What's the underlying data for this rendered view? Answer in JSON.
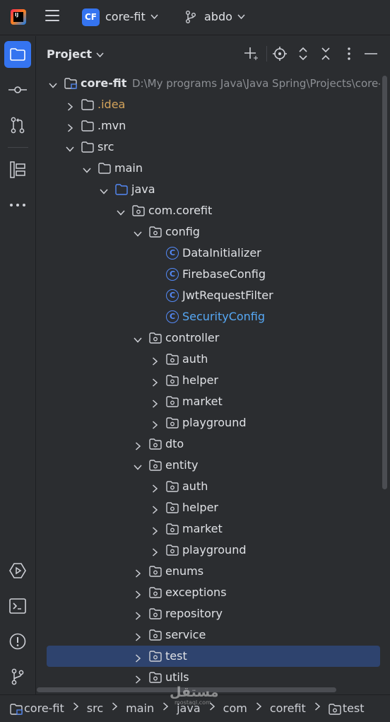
{
  "titlebar": {
    "project_initials": "CF",
    "project_name": "core-fit",
    "branch_name": "abdo"
  },
  "panel": {
    "title": "Project"
  },
  "tree": [
    {
      "label": "core-fit",
      "path": "D:\\My programs Java\\Java Spring\\Projects\\core-fit",
      "depth": 0,
      "state": "open",
      "icon": "module",
      "style": "bold"
    },
    {
      "label": ".idea",
      "depth": 1,
      "state": "closed",
      "icon": "folder",
      "style": "orange"
    },
    {
      "label": ".mvn",
      "depth": 1,
      "state": "closed",
      "icon": "folder"
    },
    {
      "label": "src",
      "depth": 1,
      "state": "open",
      "icon": "folder"
    },
    {
      "label": "main",
      "depth": 2,
      "state": "open",
      "icon": "folder"
    },
    {
      "label": "java",
      "depth": 3,
      "state": "open",
      "icon": "source-folder"
    },
    {
      "label": "com.corefit",
      "depth": 4,
      "state": "open",
      "icon": "package"
    },
    {
      "label": "config",
      "depth": 5,
      "state": "open",
      "icon": "package"
    },
    {
      "label": "DataInitializer",
      "depth": 6,
      "state": "leaf",
      "icon": "class"
    },
    {
      "label": "FirebaseConfig",
      "depth": 6,
      "state": "leaf",
      "icon": "class"
    },
    {
      "label": "JwtRequestFilter",
      "depth": 6,
      "state": "leaf",
      "icon": "class"
    },
    {
      "label": "SecurityConfig",
      "depth": 6,
      "state": "leaf",
      "icon": "class",
      "style": "blue"
    },
    {
      "label": "controller",
      "depth": 5,
      "state": "open",
      "icon": "package"
    },
    {
      "label": "auth",
      "depth": 6,
      "state": "closed",
      "icon": "package"
    },
    {
      "label": "helper",
      "depth": 6,
      "state": "closed",
      "icon": "package"
    },
    {
      "label": "market",
      "depth": 6,
      "state": "closed",
      "icon": "package"
    },
    {
      "label": "playground",
      "depth": 6,
      "state": "closed",
      "icon": "package"
    },
    {
      "label": "dto",
      "depth": 5,
      "state": "closed",
      "icon": "package"
    },
    {
      "label": "entity",
      "depth": 5,
      "state": "open",
      "icon": "package"
    },
    {
      "label": "auth",
      "depth": 6,
      "state": "closed",
      "icon": "package"
    },
    {
      "label": "helper",
      "depth": 6,
      "state": "closed",
      "icon": "package"
    },
    {
      "label": "market",
      "depth": 6,
      "state": "closed",
      "icon": "package"
    },
    {
      "label": "playground",
      "depth": 6,
      "state": "closed",
      "icon": "package"
    },
    {
      "label": "enums",
      "depth": 5,
      "state": "closed",
      "icon": "package"
    },
    {
      "label": "exceptions",
      "depth": 5,
      "state": "closed",
      "icon": "package"
    },
    {
      "label": "repository",
      "depth": 5,
      "state": "closed",
      "icon": "package"
    },
    {
      "label": "service",
      "depth": 5,
      "state": "closed",
      "icon": "package"
    },
    {
      "label": "test",
      "depth": 5,
      "state": "closed",
      "icon": "package",
      "selected": true
    },
    {
      "label": "utils",
      "depth": 5,
      "state": "closed",
      "icon": "package"
    }
  ],
  "breadcrumb": [
    {
      "label": "core-fit",
      "icon": "module"
    },
    {
      "label": "src"
    },
    {
      "label": "main"
    },
    {
      "label": "java"
    },
    {
      "label": "com"
    },
    {
      "label": "corefit"
    },
    {
      "label": "test",
      "icon": "package"
    }
  ],
  "watermark": {
    "text": "مستقل",
    "sub": "mostaql.com"
  },
  "colors": {
    "background": "#2b2d30",
    "accent": "#3574f0",
    "selection": "#2e436e",
    "folder_orange": "#d5a45b",
    "class_blue": "#548af7"
  }
}
